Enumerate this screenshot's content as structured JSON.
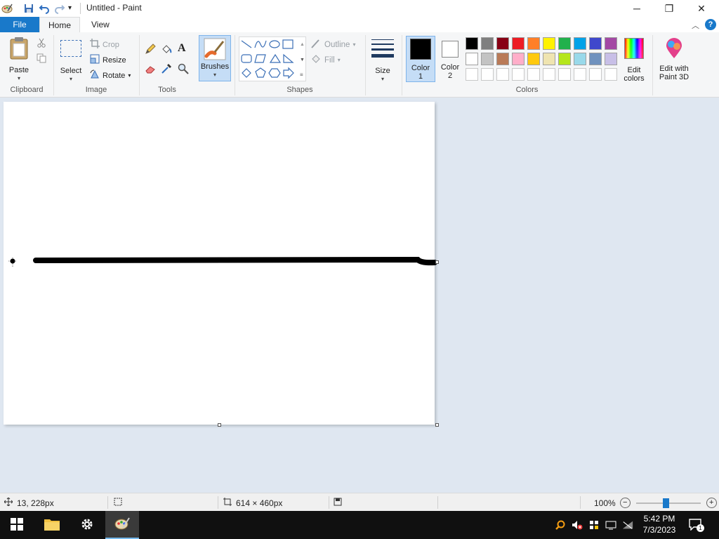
{
  "window": {
    "title": "Untitled - Paint",
    "controls": {
      "minimize": "─",
      "maximize": "❐",
      "close": "✕"
    }
  },
  "tabs": {
    "file": "File",
    "home": "Home",
    "view": "View"
  },
  "ribbon": {
    "clipboard": {
      "group": "Clipboard",
      "paste": "Paste"
    },
    "image": {
      "group": "Image",
      "select": "Select",
      "crop": "Crop",
      "resize": "Resize",
      "rotate": "Rotate"
    },
    "tools": {
      "group": "Tools"
    },
    "brushes": {
      "label": "Brushes"
    },
    "shapes": {
      "group": "Shapes",
      "outline": "Outline",
      "fill": "Fill"
    },
    "size": {
      "label": "Size"
    },
    "colors": {
      "group": "Colors",
      "color1": "Color",
      "color1_num": "1",
      "color2": "Color",
      "color2_num": "2",
      "edit_colors_1": "Edit",
      "edit_colors_2": "colors",
      "paint3d_1": "Edit with",
      "paint3d_2": "Paint 3D",
      "row1": [
        "#000000",
        "#7f7f7f",
        "#880015",
        "#ed1c24",
        "#ff7f27",
        "#fff200",
        "#22b14c",
        "#00a2e8",
        "#3f48cc",
        "#a349a4"
      ],
      "row2": [
        "#ffffff",
        "#c3c3c3",
        "#b97a57",
        "#ffaec9",
        "#ffc90e",
        "#efe4b0",
        "#b5e61d",
        "#99d9ea",
        "#7092be",
        "#c8bfe7"
      ],
      "row3": [
        "#ffffff",
        "#ffffff",
        "#ffffff",
        "#ffffff",
        "#ffffff",
        "#ffffff",
        "#ffffff",
        "#ffffff",
        "#ffffff",
        "#ffffff"
      ],
      "color1_value": "#000000",
      "color2_value": "#ffffff"
    }
  },
  "status": {
    "cursor_pos": "13, 228px",
    "canvas_size": "614 × 460px",
    "zoom": "100%"
  },
  "taskbar": {
    "time": "5:42 PM",
    "date": "7/3/2023",
    "notifications": "1"
  }
}
